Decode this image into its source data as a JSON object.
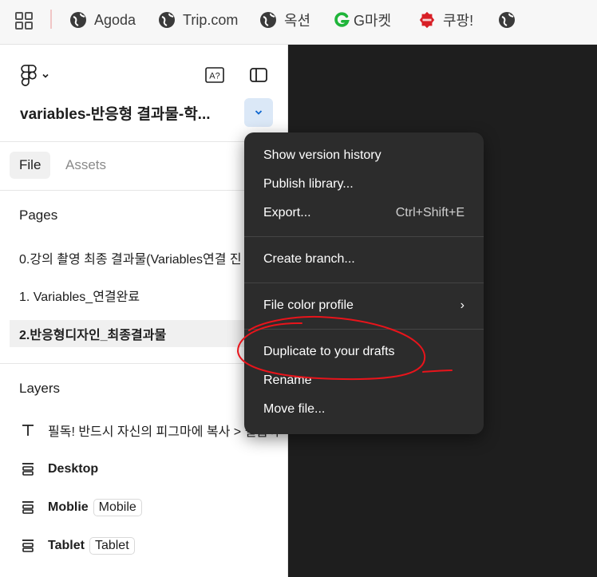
{
  "bookmarks": [
    {
      "label": "Agoda",
      "icon": "globe-icon"
    },
    {
      "label": "Trip.com",
      "icon": "globe-icon"
    },
    {
      "label": "옥션",
      "icon": "globe-icon"
    },
    {
      "label": "G마켓",
      "icon": "gmarket-icon"
    },
    {
      "label": "쿠팡!",
      "icon": "coupang-icon"
    },
    {
      "label": "",
      "icon": "globe-icon"
    }
  ],
  "header": {
    "file_title": "variables-반응형 결과물-학..."
  },
  "tabs": [
    {
      "label": "File",
      "active": true
    },
    {
      "label": "Assets",
      "active": false
    }
  ],
  "pages": {
    "heading": "Pages",
    "items": [
      {
        "label": "0.강의 촬영 최종 결과물(Variables연결 진",
        "selected": false
      },
      {
        "label": "1. Variables_연결완료",
        "selected": false
      },
      {
        "label": "2.반응형디자인_최종결과물",
        "selected": true
      }
    ]
  },
  "layers": {
    "heading": "Layers",
    "items": [
      {
        "label": "필독! 반드시 자신의 피그마에 복사 > 실습하",
        "tag": "",
        "icon": "text-icon",
        "bold": false
      },
      {
        "label": "Desktop",
        "tag": "",
        "icon": "auto-layout-icon",
        "bold": true
      },
      {
        "label": "Moblie",
        "tag": "Mobile",
        "icon": "auto-layout-icon",
        "bold": true
      },
      {
        "label": "Tablet",
        "tag": "Tablet",
        "icon": "auto-layout-icon",
        "bold": true
      }
    ]
  },
  "menu": {
    "items": [
      {
        "label": "Show version history",
        "shortcut": ""
      },
      {
        "label": "Publish library...",
        "shortcut": ""
      },
      {
        "label": "Export...",
        "shortcut": "Ctrl+Shift+E"
      },
      {
        "label": "Create branch...",
        "shortcut": ""
      },
      {
        "label": "File color profile",
        "shortcut": "›"
      },
      {
        "label": "Duplicate to your drafts",
        "shortcut": ""
      },
      {
        "label": "Rename",
        "shortcut": ""
      },
      {
        "label": "Move file...",
        "shortcut": ""
      }
    ]
  },
  "colors": {
    "menu_bg": "#2c2c2c",
    "canvas_bg": "#1e1e1e",
    "annotation": "#e8141b",
    "dropdown_active": "#dbe8f7"
  }
}
